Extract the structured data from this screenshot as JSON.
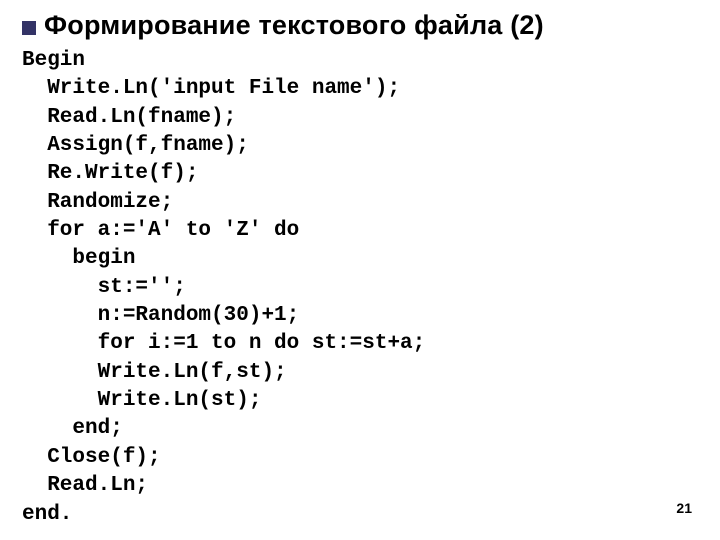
{
  "title": "Формирование текстового файла (2)",
  "code": {
    "l0": "Begin",
    "l1": "  Write.Ln('input File name');",
    "l2": "  Read.Ln(fname);",
    "l3": "  Assign(f,fname);",
    "l4": "  Re.Write(f);",
    "l5": "  Randomize;",
    "l6": "  for a:='A' to 'Z' do",
    "l7": "    begin",
    "l8": "      st:='';",
    "l9": "      n:=Random(30)+1;",
    "l10": "      for i:=1 to n do st:=st+a;",
    "l11": "      Write.Ln(f,st);",
    "l12": "      Write.Ln(st);",
    "l13": "    end;",
    "l14": "  Close(f);",
    "l15": "  Read.Ln;",
    "l16": "end."
  },
  "pagenum": "21"
}
